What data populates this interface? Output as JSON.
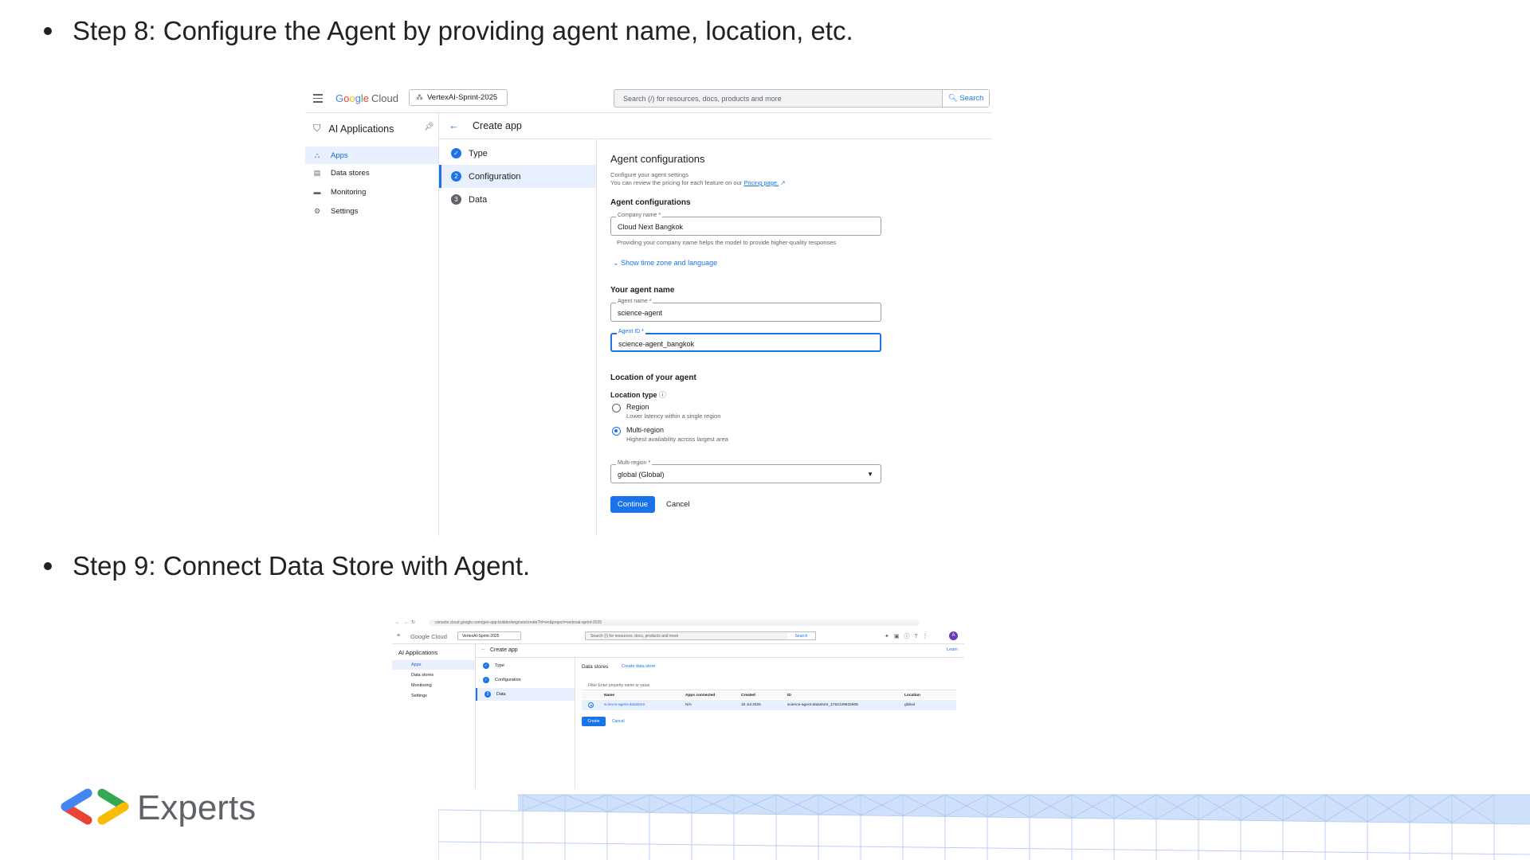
{
  "bullets": [
    "Step 8: Configure the Agent by providing agent name, location, etc.",
    "Step 9: Connect Data Store with Agent."
  ],
  "shot1": {
    "brand": {
      "g1": "G",
      "g2": "o",
      "g3": "o",
      "g4": "g",
      "g5": "l",
      "g6": "e",
      "cloud": "Cloud"
    },
    "project": "VertexAI-Sprint-2025",
    "search_placeholder": "Search (/) for resources, docs, products and more",
    "search_button": "Search",
    "product_title": "AI Applications",
    "nav": [
      "Apps",
      "Data stores",
      "Monitoring",
      "Settings"
    ],
    "page_title": "Create app",
    "steps": [
      {
        "num": "✓",
        "label": "Type"
      },
      {
        "num": "2",
        "label": "Configuration"
      },
      {
        "num": "3",
        "label": "Data"
      }
    ],
    "form": {
      "heading": "Agent configurations",
      "sub1": "Configure your agent settings",
      "sub2": "You can review the pricing for each feature on our",
      "pricing_link": "Pricing page.",
      "section1": "Agent configurations",
      "company_label": "Company name *",
      "company_value": "Cloud Next Bangkok",
      "company_helper": "Providing your company name helps the model to provide higher-quality responses",
      "show_tz": "Show time zone and language",
      "section2": "Your agent name",
      "agent_name_label": "Agent name *",
      "agent_name_value": "science-agent",
      "agent_id_label": "Agent ID *",
      "agent_id_value": "science-agent_bangkok",
      "section3": "Location of your agent",
      "location_type": "Location type",
      "region_label": "Region",
      "region_desc": "Lower latency within a single region",
      "multi_label": "Multi-region",
      "multi_desc": "Highest availability across largest area",
      "select_label": "Multi-region *",
      "select_value": "global (Global)",
      "continue": "Continue",
      "cancel": "Cancel"
    }
  },
  "shot2": {
    "url": "console.cloud.google.com/gen-app-builder/engines/create?hl=en&project=vertexai-sprint-2025",
    "logo": "Google Cloud",
    "project": "VertexAI-Sprint-2025",
    "search_placeholder": "Search (/) for resources, docs, products and more",
    "search_button": "Search",
    "avatar": "A",
    "product_title": "AI Applications",
    "nav": [
      "Apps",
      "Data stores",
      "Monitoring",
      "Settings"
    ],
    "page_title": "Create app",
    "learn": "Learn",
    "steps": [
      {
        "num": "✓",
        "label": "Type"
      },
      {
        "num": "✓",
        "label": "Configuration"
      },
      {
        "num": "3",
        "label": "Data"
      }
    ],
    "data_stores": "Data stores",
    "create_ds": "Create data store",
    "filter": "Filter  Enter property name or value",
    "columns": [
      "Name",
      "Apps connected",
      "Created",
      "ID",
      "Location"
    ],
    "row": [
      "science-agent-datastore",
      "N/A",
      "15 Jul 2025",
      "science-agent-datastore_1752129932906",
      "global"
    ],
    "create": "Create",
    "cancel": "Cancel"
  },
  "brand_text": "Experts",
  "colors": {
    "accent": "#1a73e8",
    "logo_red": "#ea4335",
    "logo_blue": "#4285f4",
    "logo_green": "#34a853",
    "logo_yellow": "#fbbc04",
    "deco_blue": "#cfe0fb"
  }
}
